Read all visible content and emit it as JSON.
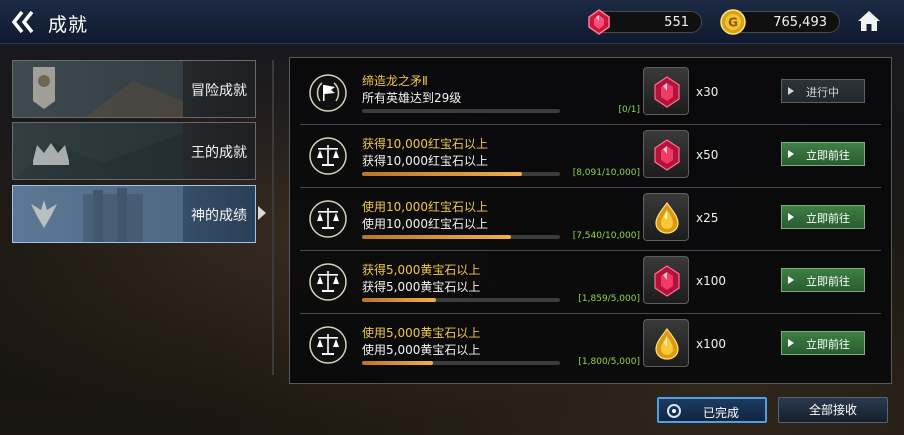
{
  "header": {
    "title": "成就",
    "back_icon": "double-chevron-left-icon",
    "home_icon": "home-icon"
  },
  "currencies": [
    {
      "icon": "ruby-gem-icon",
      "value": "551",
      "color": "#d4244a"
    },
    {
      "icon": "gold-coin-icon",
      "value": "765,493",
      "color": "#e0a818"
    }
  ],
  "tabs": [
    {
      "label": "冒险成就",
      "selected": false
    },
    {
      "label": "王的成就",
      "selected": false
    },
    {
      "label": "神的成绩",
      "selected": true
    }
  ],
  "achievements": [
    {
      "title": "缔造龙之矛Ⅱ",
      "desc": "所有英雄达到29级",
      "progress_text": "[0/1]",
      "progress": 0.0,
      "reward_icon": "ruby-gem-icon",
      "reward_qty": "x30",
      "action": "进行中",
      "action_state": "in-progress"
    },
    {
      "title": "获得10,000红宝石以上",
      "desc": "获得10,000红宝石以上",
      "progress_text": "[8,091/10,000]",
      "progress": 0.809,
      "reward_icon": "ruby-gem-icon",
      "reward_qty": "x50",
      "action": "立即前往",
      "action_state": "go"
    },
    {
      "title": "使用10,000红宝石以上",
      "desc": "使用10,000红宝石以上",
      "progress_text": "[7,540/10,000]",
      "progress": 0.754,
      "reward_icon": "topaz-gem-icon",
      "reward_qty": "x25",
      "action": "立即前往",
      "action_state": "go"
    },
    {
      "title": "获得5,000黄宝石以上",
      "desc": "获得5,000黄宝石以上",
      "progress_text": "[1,859/5,000]",
      "progress": 0.372,
      "reward_icon": "ruby-gem-icon",
      "reward_qty": "x100",
      "action": "立即前往",
      "action_state": "go"
    },
    {
      "title": "使用5,000黄宝石以上",
      "desc": "使用5,000黄宝石以上",
      "progress_text": "[1,800/5,000]",
      "progress": 0.36,
      "reward_icon": "topaz-gem-icon",
      "reward_qty": "x100",
      "action": "立即前往",
      "action_state": "go"
    }
  ],
  "footer": {
    "completed_label": "已完成",
    "receive_all_label": "全部接收"
  },
  "colors": {
    "title_gold": "#f0c84a",
    "progress_green": "#8fd44a",
    "go_button": "#3e7f44",
    "selected_tab_border": "#9cc4ea"
  }
}
